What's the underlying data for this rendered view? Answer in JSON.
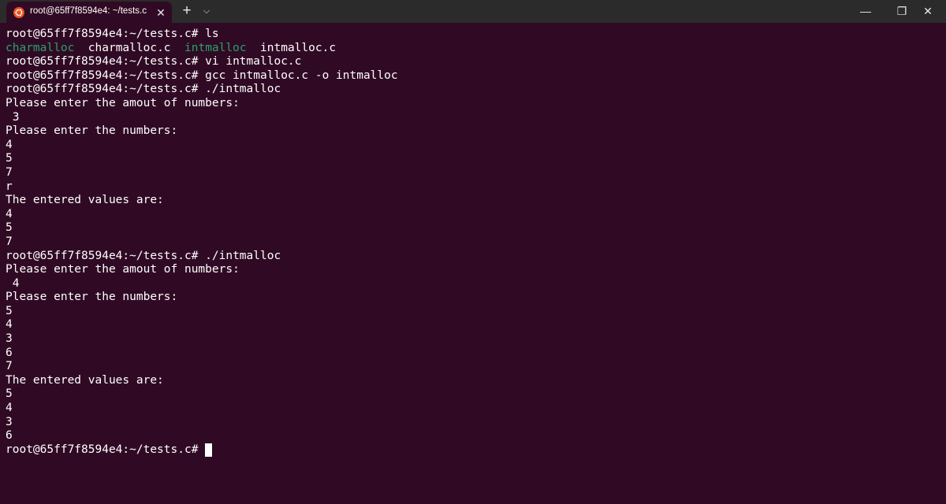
{
  "window": {
    "tab_title": "root@65ff7f8594e4: ~/tests.c",
    "tab_icon": "ubuntu-icon",
    "close_tab_icon": "close-icon",
    "new_tab_icon": "plus-icon",
    "dropdown_icon": "chevron-down-icon",
    "minimize_icon": "minimize-icon",
    "restore_icon": "restore-icon",
    "close_icon": "close-icon",
    "titlebar_color": "#2b2b2b",
    "accent_color": "#e95420"
  },
  "terminal": {
    "background_color": "#300a24",
    "text_color": "#ffffff",
    "executable_color": "#26a269",
    "lines": [
      [
        {
          "t": "root@65ff7f8594e4:~/tests.c# ls",
          "c": "default"
        }
      ],
      [
        {
          "t": "charmalloc",
          "c": "green"
        },
        {
          "t": "  charmalloc.c  ",
          "c": "default"
        },
        {
          "t": "intmalloc",
          "c": "green"
        },
        {
          "t": "  intmalloc.c",
          "c": "default"
        }
      ],
      [
        {
          "t": "root@65ff7f8594e4:~/tests.c# vi intmalloc.c",
          "c": "default"
        }
      ],
      [
        {
          "t": "root@65ff7f8594e4:~/tests.c# gcc intmalloc.c -o intmalloc",
          "c": "default"
        }
      ],
      [
        {
          "t": "root@65ff7f8594e4:~/tests.c# ./intmalloc",
          "c": "default"
        }
      ],
      [
        {
          "t": "Please enter the amout of numbers:",
          "c": "default"
        }
      ],
      [
        {
          "t": " 3",
          "c": "default"
        }
      ],
      [
        {
          "t": "Please enter the numbers:",
          "c": "default"
        }
      ],
      [
        {
          "t": "4",
          "c": "default"
        }
      ],
      [
        {
          "t": "5",
          "c": "default"
        }
      ],
      [
        {
          "t": "7",
          "c": "default"
        }
      ],
      [
        {
          "t": "r",
          "c": "default"
        }
      ],
      [
        {
          "t": "The entered values are:",
          "c": "default"
        }
      ],
      [
        {
          "t": "4",
          "c": "default"
        }
      ],
      [
        {
          "t": "5",
          "c": "default"
        }
      ],
      [
        {
          "t": "7",
          "c": "default"
        }
      ],
      [
        {
          "t": "root@65ff7f8594e4:~/tests.c# ./intmalloc",
          "c": "default"
        }
      ],
      [
        {
          "t": "Please enter the amout of numbers:",
          "c": "default"
        }
      ],
      [
        {
          "t": " 4",
          "c": "default"
        }
      ],
      [
        {
          "t": "Please enter the numbers:",
          "c": "default"
        }
      ],
      [
        {
          "t": "5",
          "c": "default"
        }
      ],
      [
        {
          "t": "4",
          "c": "default"
        }
      ],
      [
        {
          "t": "3",
          "c": "default"
        }
      ],
      [
        {
          "t": "6",
          "c": "default"
        }
      ],
      [
        {
          "t": "7",
          "c": "default"
        }
      ],
      [
        {
          "t": "The entered values are:",
          "c": "default"
        }
      ],
      [
        {
          "t": "5",
          "c": "default"
        }
      ],
      [
        {
          "t": "4",
          "c": "default"
        }
      ],
      [
        {
          "t": "3",
          "c": "default"
        }
      ],
      [
        {
          "t": "6",
          "c": "default"
        }
      ]
    ],
    "prompt": "root@65ff7f8594e4:~/tests.c# "
  }
}
